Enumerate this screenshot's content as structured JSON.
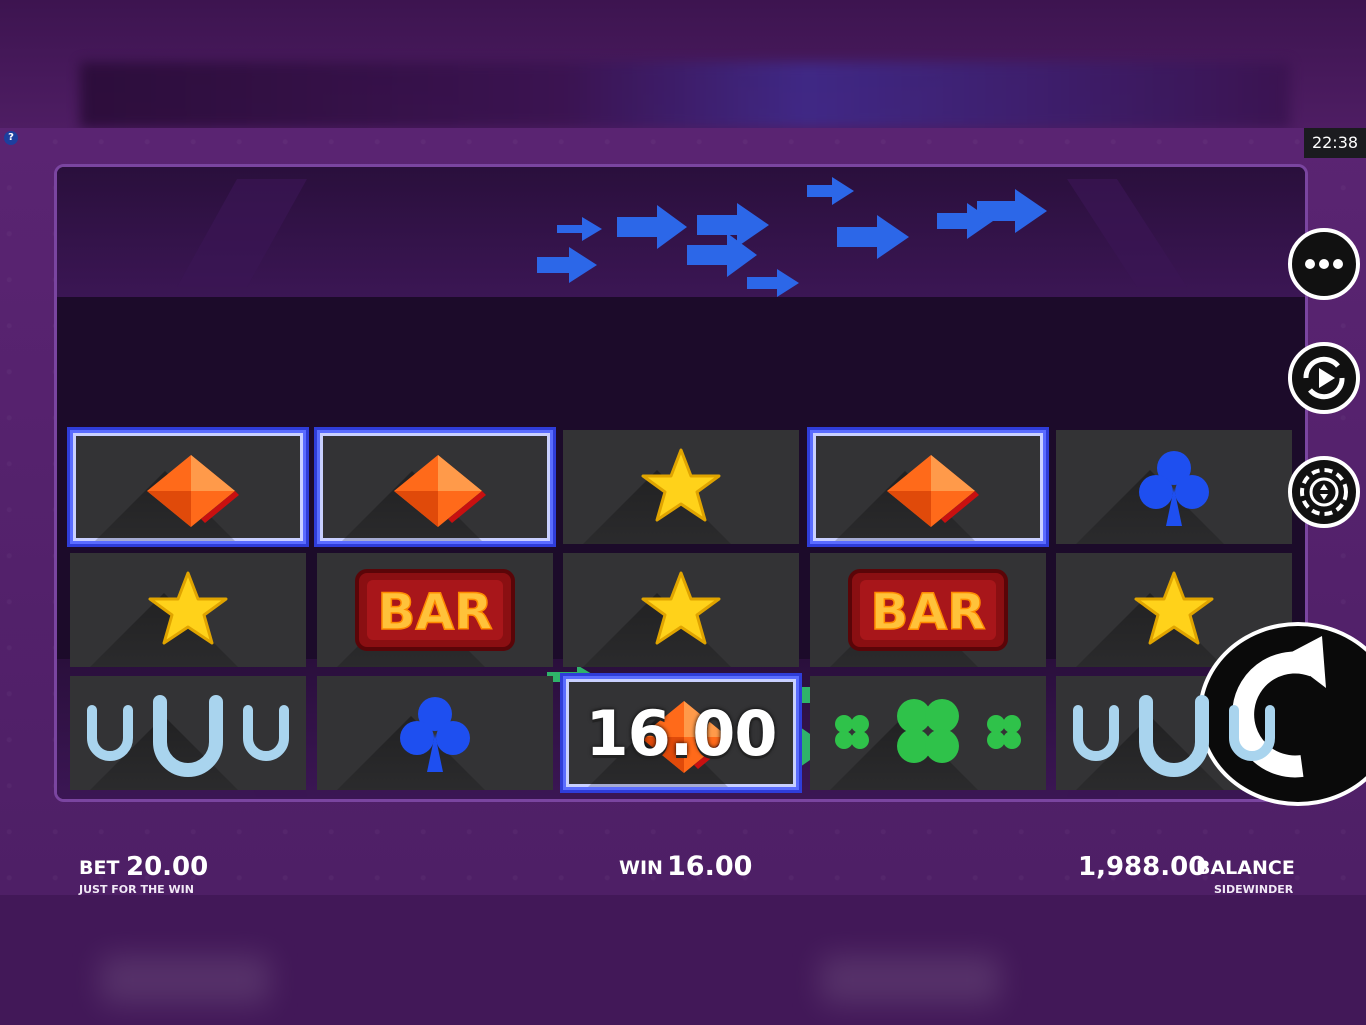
{
  "status": {
    "clock": "22:38",
    "help_label": "?"
  },
  "reels": {
    "rows": [
      [
        "diamond",
        "diamond",
        "star",
        "diamond",
        "club"
      ],
      [
        "star",
        "bar",
        "star",
        "bar",
        "star"
      ],
      [
        "horseshoe",
        "club",
        "diamond",
        "clover",
        "horseshoe"
      ]
    ],
    "win_cells": [
      [
        0,
        0
      ],
      [
        0,
        1
      ],
      [
        0,
        3
      ],
      [
        2,
        2
      ]
    ],
    "bar_label": "BAR",
    "win_overlay": "16.00"
  },
  "footer": {
    "bet_label": "BET",
    "bet_value": "20.00",
    "game_name": "JUST FOR THE WIN",
    "win_label": "WIN",
    "win_value": "16.00",
    "balance_value": "1,988.00",
    "balance_label": "BALANCE",
    "studio_name": "SIDEWINDER"
  },
  "controls": [
    "menu-icon",
    "autoplay-icon",
    "bet-chip-icon",
    "spin-icon"
  ],
  "colors": {
    "background": "#4a1d5e",
    "win_border": "#4c5cff",
    "cell": "#333335",
    "accent_blue": "#2f6df0",
    "accent_green": "#2fb36a"
  }
}
